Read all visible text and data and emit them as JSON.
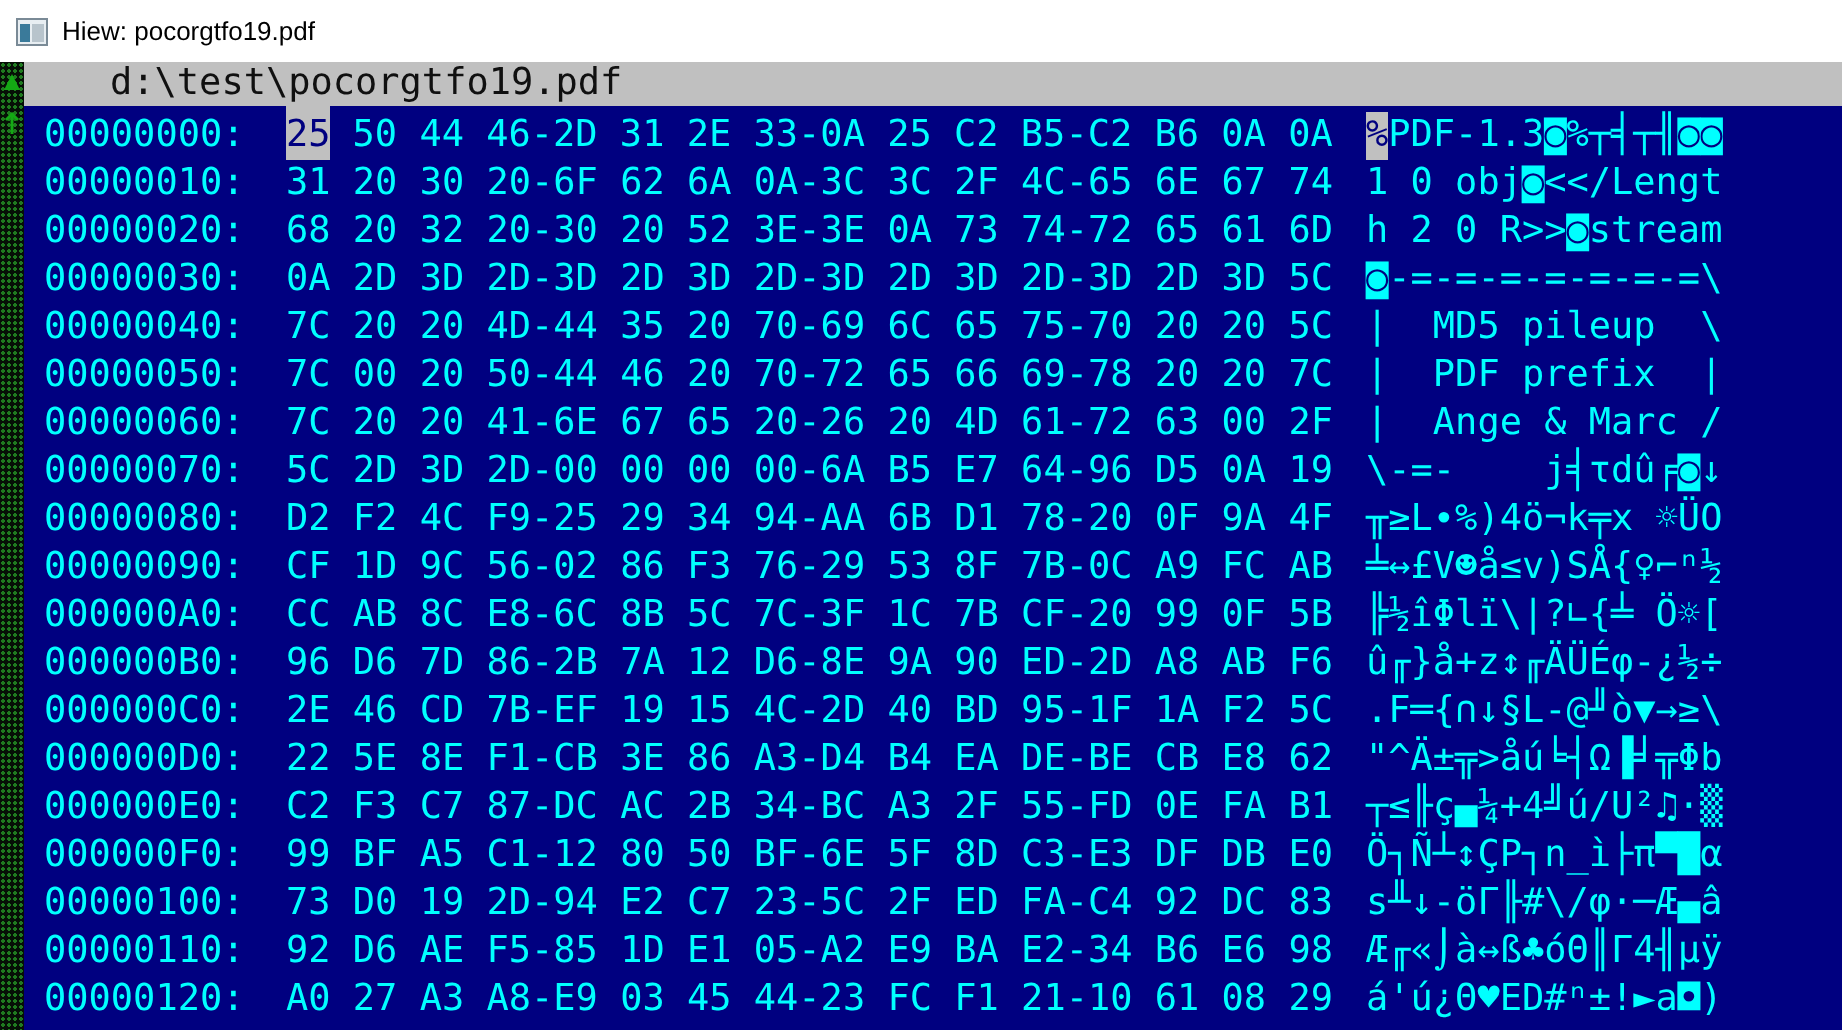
{
  "window": {
    "title": "Hiew: pocorgtfo19.pdf"
  },
  "header": {
    "path": "d:\\test\\pocorgtfo19.pdf"
  },
  "rows": [
    {
      "offset": "00000000:",
      "cursor": {
        "hex": "25",
        "char": "%"
      },
      "hex": "50 44 46-2D 31 2E 33-0A 25 C2 B5-C2 B6 0A 0A",
      "ascii": "PDF-1.3◙%┬╡┬╢◙◙"
    },
    {
      "offset": "00000010:",
      "hex": "31 20 30 20-6F 62 6A 0A-3C 3C 2F 4C-65 6E 67 74",
      "ascii": "1 0 obj◙<</Lengt"
    },
    {
      "offset": "00000020:",
      "hex": "68 20 32 20-30 20 52 3E-3E 0A 73 74-72 65 61 6D",
      "ascii": "h 2 0 R>>◙stream"
    },
    {
      "offset": "00000030:",
      "hex": "0A 2D 3D 2D-3D 2D 3D 2D-3D 2D 3D 2D-3D 2D 3D 5C",
      "ascii": "◙-=-=-=-=-=-=-=\\"
    },
    {
      "offset": "00000040:",
      "hex": "7C 20 20 4D-44 35 20 70-69 6C 65 75-70 20 20 5C",
      "ascii": "|  MD5 pileup  \\"
    },
    {
      "offset": "00000050:",
      "hex": "7C 00 20 50-44 46 20 70-72 65 66 69-78 20 20 7C",
      "ascii": "|  PDF prefix  |"
    },
    {
      "offset": "00000060:",
      "hex": "7C 20 20 41-6E 67 65 20-26 20 4D 61-72 63 00 2F",
      "ascii": "|  Ange & Marc /"
    },
    {
      "offset": "00000070:",
      "hex": "5C 2D 3D 2D-00 00 00 00-6A B5 E7 64-96 D5 0A 19",
      "ascii": "\\-=-    j╡τdû╒◙↓"
    },
    {
      "offset": "00000080:",
      "hex": "D2 F2 4C F9-25 29 34 94-AA 6B D1 78-20 0F 9A 4F",
      "ascii": "╥≥L∙%)4ö¬k╤x ☼ÜO"
    },
    {
      "offset": "00000090:",
      "hex": "CF 1D 9C 56-02 86 F3 76-29 53 8F 7B-0C A9 FC AB",
      "ascii": "╧↔£V☻å≤v)SÅ{♀⌐ⁿ½"
    },
    {
      "offset": "000000A0:",
      "hex": "CC AB 8C E8-6C 8B 5C 7C-3F 1C 7B CF-20 99 0F 5B",
      "ascii": "╠½îΦlï\\|?∟{╧ Ö☼["
    },
    {
      "offset": "000000B0:",
      "hex": "96 D6 7D 86-2B 7A 12 D6-8E 9A 90 ED-2D A8 AB F6",
      "ascii": "û╓}å+z↕╓ÄÜÉφ-¿½÷"
    },
    {
      "offset": "000000C0:",
      "hex": "2E 46 CD 7B-EF 19 15 4C-2D 40 BD 95-1F 1A F2 5C",
      "ascii": ".F═{∩↓§L-@╜ò▼→≥\\"
    },
    {
      "offset": "000000D0:",
      "hex": "22 5E 8E F1-CB 3E 86 A3-D4 B4 EA DE-BE CB E8 62",
      "ascii": "\"^Ä±╦>åú╘┤Ω▐╛╦Φb"
    },
    {
      "offset": "000000E0:",
      "hex": "C2 F3 C7 87-DC AC 2B 34-BC A3 2F 55-FD 0E FA B1",
      "ascii": "┬≤╟ç▄¼+4╝ú/U²♫·▒"
    },
    {
      "offset": "000000F0:",
      "hex": "99 BF A5 C1-12 80 50 BF-6E 5F 8D C3-E3 DF DB E0",
      "ascii": "Ö┐Ñ┴↕ÇP┐n_ì├π▀█α"
    },
    {
      "offset": "00000100:",
      "hex": "73 D0 19 2D-94 E2 C7 23-5C 2F ED FA-C4 92 DC 83",
      "ascii": "s╨↓-öΓ╟#\\/φ·─Æ▄â"
    },
    {
      "offset": "00000110:",
      "hex": "92 D6 AE F5-85 1D E1 05-A2 E9 BA E2-34 B6 E6 98",
      "ascii": "Æ╓«⌡à↔ß♣óΘ║Γ4╢µÿ"
    },
    {
      "offset": "00000120:",
      "hex": "A0 27 A3 A8-E9 03 45 44-23 FC F1 21-10 61 08 29",
      "ascii": "á'ú¿Θ♥ED#ⁿ±!►a◘)"
    }
  ]
}
